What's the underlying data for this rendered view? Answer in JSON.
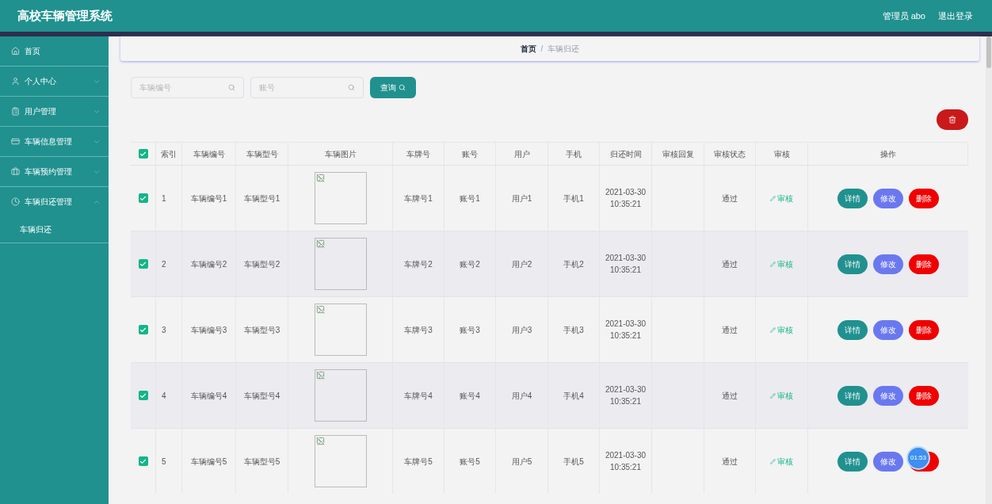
{
  "header": {
    "title": "高校车辆管理系统",
    "user": "管理员 abo",
    "logout": "退出登录"
  },
  "sidebar": {
    "items": [
      {
        "label": "首页",
        "expandable": false
      },
      {
        "label": "个人中心",
        "expandable": true,
        "expanded": false
      },
      {
        "label": "用户管理",
        "expandable": true,
        "expanded": false
      },
      {
        "label": "车辆信息管理",
        "expandable": true,
        "expanded": false
      },
      {
        "label": "车辆预约管理",
        "expandable": true,
        "expanded": false
      },
      {
        "label": "车辆归还管理",
        "expandable": true,
        "expanded": true,
        "children": [
          {
            "label": "车辆归还"
          }
        ]
      }
    ]
  },
  "breadcrumb": [
    {
      "label": "首页",
      "selected": false
    },
    {
      "label": "车辆归还",
      "selected": true
    }
  ],
  "breadcrumb_separator": "/",
  "search": {
    "fields": [
      {
        "placeholder": "车辆编号"
      },
      {
        "placeholder": "账号"
      }
    ],
    "button": "查询"
  },
  "table": {
    "columns": [
      "索引",
      "车辆编号",
      "车辆型号",
      "车辆图片",
      "车牌号",
      "账号",
      "用户",
      "手机",
      "归还时间",
      "审核回复",
      "审核状态",
      "审核",
      "操作"
    ],
    "all_checked": true,
    "rows": [
      {
        "checked": true,
        "cells": [
          "1",
          "车辆编号1",
          "车辆型号1",
          "",
          "车牌号1",
          "账号1",
          "用户1",
          "手机1",
          "2021-03-30 10:35:21",
          "",
          "通过"
        ],
        "review": "审核",
        "actions": [
          {
            "kind": "detail",
            "label": "详情"
          },
          {
            "kind": "edit",
            "label": "修改"
          },
          {
            "kind": "delete",
            "label": "删除"
          }
        ]
      },
      {
        "checked": true,
        "cells": [
          "2",
          "车辆编号2",
          "车辆型号2",
          "",
          "车牌号2",
          "账号2",
          "用户2",
          "手机2",
          "2021-03-30 10:35:21",
          "",
          "通过"
        ],
        "review": "审核",
        "actions": [
          {
            "kind": "detail",
            "label": "详情"
          },
          {
            "kind": "edit",
            "label": "修改"
          },
          {
            "kind": "delete",
            "label": "删除"
          }
        ]
      },
      {
        "checked": true,
        "cells": [
          "3",
          "车辆编号3",
          "车辆型号3",
          "",
          "车牌号3",
          "账号3",
          "用户3",
          "手机3",
          "2021-03-30 10:35:21",
          "",
          "通过"
        ],
        "review": "审核",
        "actions": [
          {
            "kind": "detail",
            "label": "详情"
          },
          {
            "kind": "edit",
            "label": "修改"
          },
          {
            "kind": "delete",
            "label": "删除"
          }
        ]
      },
      {
        "checked": true,
        "cells": [
          "4",
          "车辆编号4",
          "车辆型号4",
          "",
          "车牌号4",
          "账号4",
          "用户4",
          "手机4",
          "2021-03-30 10:35:21",
          "",
          "通过"
        ],
        "review": "审核",
        "actions": [
          {
            "kind": "detail",
            "label": "详情"
          },
          {
            "kind": "edit",
            "label": "修改"
          },
          {
            "kind": "delete",
            "label": "删除"
          }
        ]
      },
      {
        "checked": true,
        "cells": [
          "5",
          "车辆编号5",
          "车辆型号5",
          "",
          "车牌号5",
          "账号5",
          "用户5",
          "手机5",
          "2021-03-30 10:35:21",
          "",
          "通过"
        ],
        "review": "审核",
        "actions": [
          {
            "kind": "detail",
            "label": "详情"
          },
          {
            "kind": "edit",
            "label": "修改"
          },
          {
            "kind": "delete"
          }
        ]
      }
    ]
  },
  "timer": "01:53"
}
